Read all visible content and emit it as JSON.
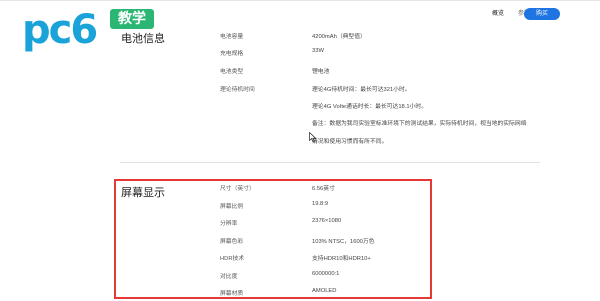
{
  "logo": {
    "text_pc": "pc",
    "text_six": "6",
    "badge": "教学"
  },
  "nav": {
    "items": [
      "概览",
      "参数规格"
    ],
    "buy": "购买"
  },
  "battery": {
    "title": "电池信息",
    "rows": [
      {
        "label": "电池容量",
        "value": "4200mAh（典型值）"
      },
      {
        "label": "充电规格",
        "value": "33W"
      },
      {
        "label": "电池类型",
        "value": "锂电池"
      },
      {
        "label": "理论待机时间",
        "value": "理论4G待机时间：最长可达321小时。"
      }
    ],
    "extra_lines": [
      "理论4G VoIte通话时长：最长可达18.1小时。",
      "备注：数据为我司实验室标准环境下的测试结果，实际待机时间，视当地的实际网络",
      "情况和使用习惯而有所不同。"
    ]
  },
  "screen": {
    "title": "屏幕显示",
    "rows": [
      {
        "label": "尺寸（英寸）",
        "value": "6.56英寸"
      },
      {
        "label": "屏幕比例",
        "value": "19.8:9"
      },
      {
        "label": "分辨率",
        "value": "2376×1080"
      },
      {
        "label": "屏幕色彩",
        "value": "103% NTSC，1600万色"
      },
      {
        "label": "HDR技术",
        "value": "支持HDR10和HDR10+"
      },
      {
        "label": "对比度",
        "value": "6000000:1"
      },
      {
        "label": "屏幕材质",
        "value": "AMOLED"
      }
    ]
  }
}
